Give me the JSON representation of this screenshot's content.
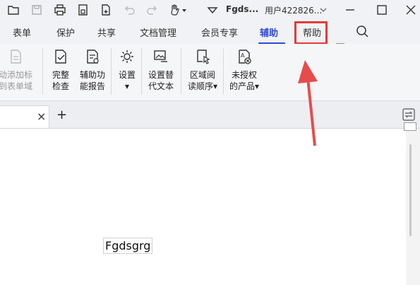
{
  "titlebar": {
    "doc_name": "Fgds...",
    "user_name": "用户422826...",
    "icons": [
      "folder-icon",
      "save-icon",
      "print-icon",
      "print-preview-icon",
      "new-file-icon",
      "undo-icon",
      "redo-icon",
      "hand-tool-icon",
      "dropdown-icon",
      "minimize-icon",
      "maximize-icon",
      "close-icon"
    ]
  },
  "menu": {
    "items": [
      "表单",
      "保护",
      "共享",
      "文档管理",
      "会员专享",
      "辅助",
      "帮助"
    ],
    "active": "辅助"
  },
  "ribbon": {
    "buttons": [
      {
        "label": "动添加标\n到表单域",
        "disabled": true
      },
      {
        "label": "完整\n检查"
      },
      {
        "label": "辅助功\n能报告"
      },
      {
        "label": "设置\n▾"
      },
      {
        "label": "设置替\n代文本"
      },
      {
        "label": "区域阅\n读顺序▾"
      },
      {
        "label": "未授权\n的产品▾"
      }
    ]
  },
  "tabs": {
    "close": "×",
    "add": "+"
  },
  "document": {
    "text": "Fgdsgrg"
  },
  "annotation": {
    "color": "#e23b3b"
  }
}
